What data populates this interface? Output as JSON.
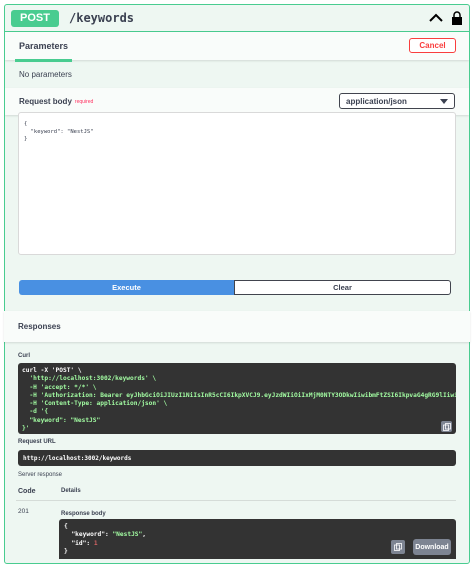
{
  "operation": {
    "method": "POST",
    "path": "/keywords",
    "accent_color": "#49cc90"
  },
  "parameters": {
    "tab_label": "Parameters",
    "cancel_label": "Cancel",
    "empty_text": "No parameters"
  },
  "request_body": {
    "title": "Request body",
    "required_label": "required",
    "content_type": "application/json",
    "editor_line1": "{",
    "editor_line2": "  \"keyword\": \"NestJS\"",
    "editor_line3": "}"
  },
  "actions": {
    "execute_label": "Execute",
    "clear_label": "Clear"
  },
  "responses": {
    "title": "Responses",
    "curl_label": "Curl",
    "curl_lines": [
      "curl -X 'POST' \\",
      "  'http://localhost:3002/keywords' \\",
      "  -H 'accept: */*' \\",
      "  -H 'Authorization: Bearer eyJhbGciOiJIUzI1NiIsInR5cCI6IkpXVCJ9.eyJzdWIiOiIxMjM0NTY3ODkwIiwibmFtZSI6IkpvaG4gRG9lIiwiaWF",
      "  -H 'Content-Type: application/json' \\",
      "  -d '{",
      "  \"keyword\": \"NestJS\"",
      "}'"
    ],
    "request_url_label": "Request URL",
    "request_url": "http://localhost:3002/keywords",
    "server_response_label": "Server response",
    "code_header": "Code",
    "details_header": "Details",
    "status_code": "201",
    "response_body_label": "Response body",
    "body_line1": "{",
    "body_key1": "\"keyword\": ",
    "body_val1": "\"NestJS\"",
    "body_comma1": ",",
    "body_key2": "\"id\": ",
    "body_val2": "1",
    "body_line4": "}",
    "download_label": "Download"
  }
}
